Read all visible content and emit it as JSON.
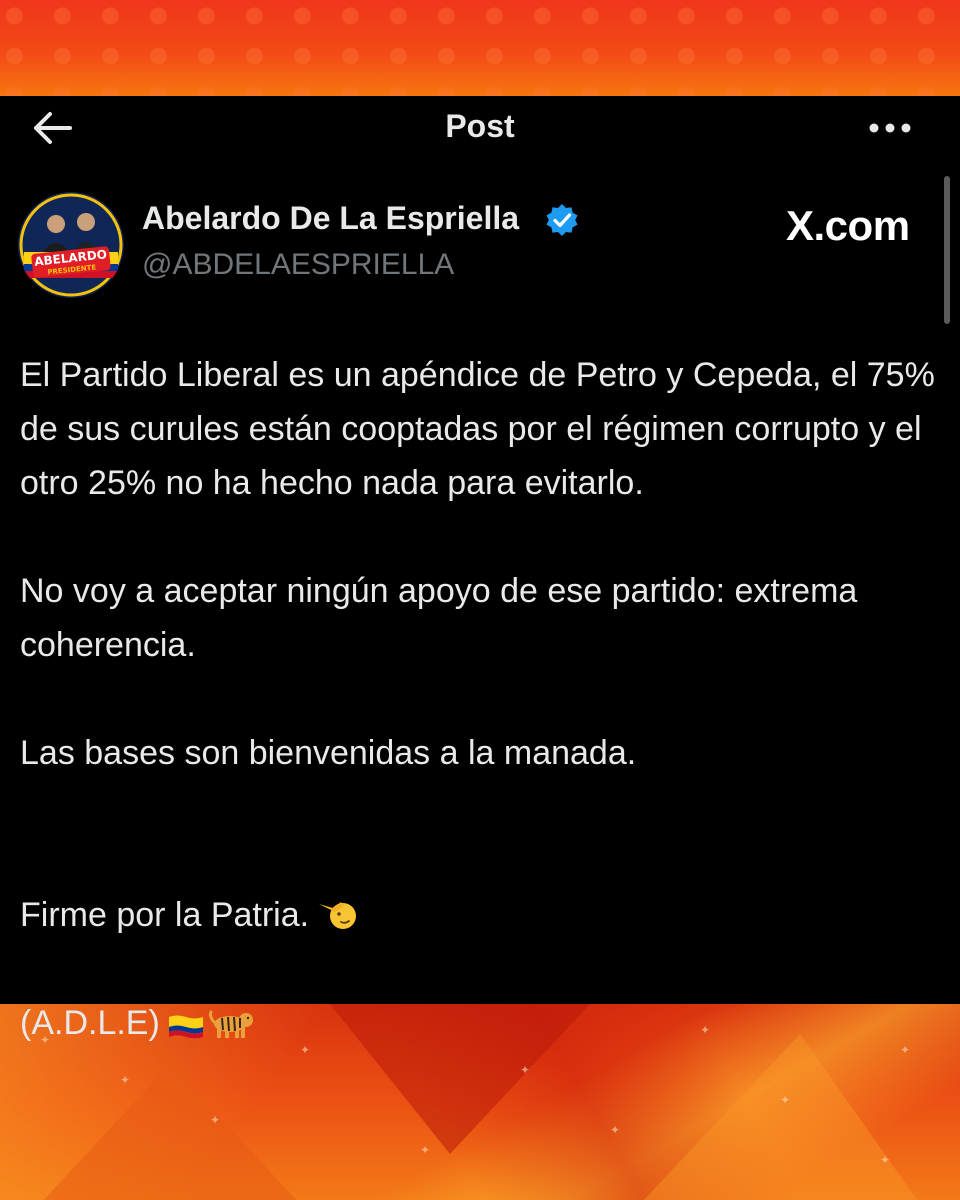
{
  "topbar": {
    "title": "Post",
    "back_icon": "arrow-left-icon",
    "more_icon": "more-horizontal-icon"
  },
  "author": {
    "name": "Abelardo De La Espriella",
    "handle": "@ABDELAESPRIELLA",
    "verified": true,
    "avatar_lettering": "ABELARDO PRESIDENTE"
  },
  "watermark": "X.com",
  "post": {
    "paragraphs": [
      "El Partido Liberal es un apéndice de Petro y Cepeda, el 75% de sus curules están cooptadas por el régimen corrupto y el otro 25% no ha hecho nada para evitarlo.",
      "No voy a aceptar ningún apoyo de ese partido: extrema coherencia.",
      "Las bases son bienvenidas a la manada."
    ],
    "closing_line_1": "Firme por la Patria.",
    "closing_line_2": "(A.D.L.E)",
    "emojis": [
      "saluting-face-icon",
      "colombia-flag-icon",
      "tiger-icon"
    ]
  },
  "colors": {
    "card_background": "#000000",
    "text_primary": "#e7e9ea",
    "text_secondary": "#71767b",
    "verified_blue": "#1d9bf0",
    "frame_orange": "#f24a16"
  }
}
